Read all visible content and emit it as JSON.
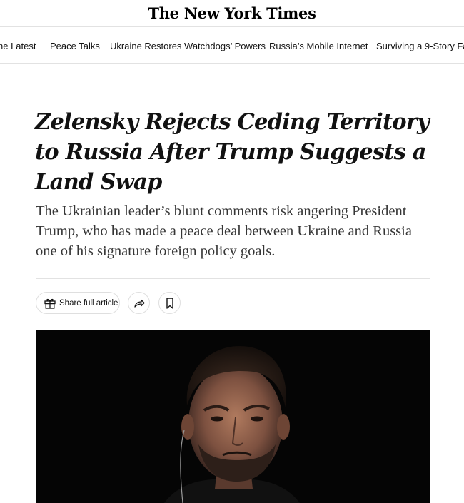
{
  "masthead": {
    "logo_text": "The New York Times"
  },
  "nav": {
    "items": [
      "he Latest",
      "Peace Talks",
      "Ukraine Restores Watchdogs’ Powers",
      "Russia’s Mobile Internet",
      "Surviving a 9-Story Fal"
    ]
  },
  "article": {
    "headline": "Zelensky Rejects Ceding Territory to Russia After Trump Suggests a Land Swap",
    "summary": "The Ukrainian leader’s blunt comments risk angering President Trump, who has made a peace deal between Ukraine and Russia one of his signature foreign policy goals."
  },
  "actions": {
    "share_label": "Share full article",
    "icons": [
      "gift-icon",
      "share-arrow-icon",
      "bookmark-icon"
    ]
  },
  "colors": {
    "text": "#121212",
    "summary_text": "#363636",
    "divider": "#e2e2e2",
    "photo_background": "#050505"
  }
}
